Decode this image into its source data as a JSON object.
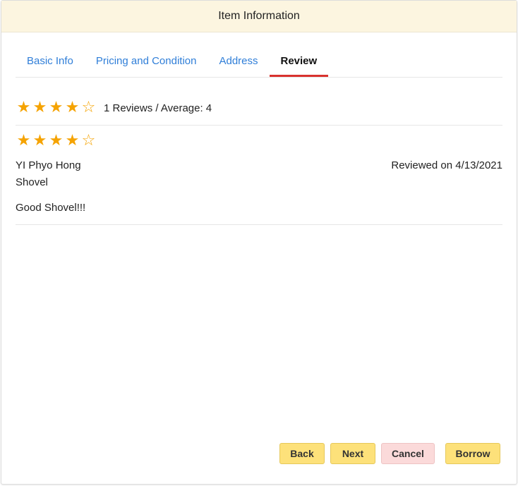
{
  "dialog": {
    "title": "Item Information"
  },
  "tabs": [
    {
      "label": "Basic Info",
      "active": false
    },
    {
      "label": "Pricing and Condition",
      "active": false
    },
    {
      "label": "Address",
      "active": false
    },
    {
      "label": "Review",
      "active": true
    }
  ],
  "summary": {
    "rating": 4,
    "max_rating": 5,
    "text": "1 Reviews / Average: 4"
  },
  "reviews": [
    {
      "rating": 4,
      "reviewer": "YI Phyo Hong",
      "date_text": "Reviewed on 4/13/2021",
      "item": "Shovel",
      "comment": "Good Shovel!!!"
    }
  ],
  "buttons": {
    "back": "Back",
    "next": "Next",
    "cancel": "Cancel",
    "borrow": "Borrow"
  },
  "colors": {
    "header_bg": "#fcf5e0",
    "tab_link": "#2f7ed8",
    "tab_active_underline": "#d9322e",
    "star": "#f5a302",
    "button_yellow": "#fde17a",
    "button_pink": "#fbdada"
  }
}
